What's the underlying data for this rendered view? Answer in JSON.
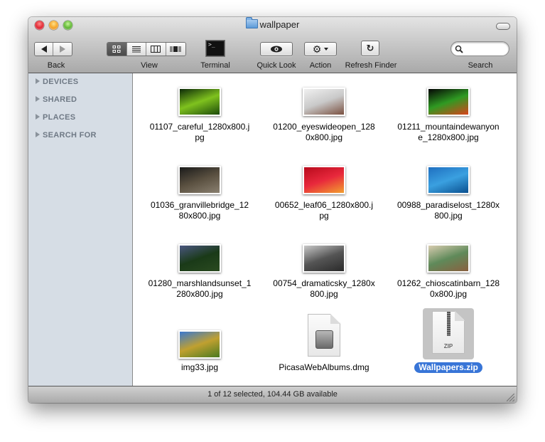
{
  "window": {
    "title": "wallpaper",
    "folder_icon": "folder-icon"
  },
  "toolbar": {
    "back_label": "Back",
    "view_label": "View",
    "terminal_label": "Terminal",
    "terminal_glyph": ">_",
    "quicklook_label": "Quick Look",
    "action_label": "Action",
    "refresh_label": "Refresh Finder",
    "search_label": "Search",
    "search_value": "",
    "view_modes": [
      "icon",
      "list",
      "column",
      "cover-flow"
    ],
    "active_view": "icon"
  },
  "sidebar": {
    "items": [
      {
        "label": "DEVICES"
      },
      {
        "label": "SHARED"
      },
      {
        "label": "PLACES"
      },
      {
        "label": "SEARCH FOR"
      }
    ]
  },
  "files": [
    {
      "line1": "01107_careful_1280x800.j",
      "line2": "pg",
      "kind": "image",
      "colors": [
        "#0c2a08",
        "#7fc21e",
        "#1c4a0a"
      ]
    },
    {
      "line1": "01200_eyeswideopen_128",
      "line2": "0x800.jpg",
      "kind": "image",
      "colors": [
        "#f0f0f0",
        "#c9c9c9",
        "#7a5040"
      ]
    },
    {
      "line1": "01211_mountaindewanyon",
      "line2": "e_1280x800.jpg",
      "kind": "image",
      "colors": [
        "#050505",
        "#2f9a22",
        "#d8431a"
      ]
    },
    {
      "line1": "01036_granvillebridge_12",
      "line2": "80x800.jpg",
      "kind": "image",
      "colors": [
        "#1a1a1a",
        "#5a5040",
        "#8a8070"
      ]
    },
    {
      "line1": "00652_leaf06_1280x800.j",
      "line2": "pg",
      "kind": "image",
      "colors": [
        "#b80a1c",
        "#e8283c",
        "#f2a030"
      ]
    },
    {
      "line1": "00988_paradiselost_1280x",
      "line2": "800.jpg",
      "kind": "image",
      "colors": [
        "#1f6fc0",
        "#3aa0e0",
        "#0a5090"
      ]
    },
    {
      "line1": "01280_marshlandsunset_1",
      "line2": "280x800.jpg",
      "kind": "image",
      "colors": [
        "#4a5680",
        "#1a3a18",
        "#2a4a20"
      ]
    },
    {
      "line1": "00754_dramaticsky_1280x",
      "line2": "800.jpg",
      "kind": "image",
      "colors": [
        "#c8c8c8",
        "#555555",
        "#2a2a2a"
      ]
    },
    {
      "line1": "01262_chioscatinbarn_128",
      "line2": "0x800.jpg",
      "kind": "image",
      "colors": [
        "#d8ccb0",
        "#5f8a5a",
        "#8a6040"
      ]
    },
    {
      "line1": "img33.jpg",
      "line2": "",
      "kind": "image",
      "colors": [
        "#3a78d0",
        "#c0a030",
        "#4a7a20"
      ]
    },
    {
      "line1": "PicasaWebAlbums.dmg",
      "line2": "",
      "kind": "dmg"
    },
    {
      "line1": "Wallpapers.zip",
      "line2": "",
      "kind": "zip",
      "selected": true,
      "badge": "ZIP"
    }
  ],
  "status": {
    "text": "1 of 12 selected, 104.44 GB available"
  },
  "colors": {
    "selection": "#3875d7",
    "sidebar_bg": "#d6dde5"
  }
}
